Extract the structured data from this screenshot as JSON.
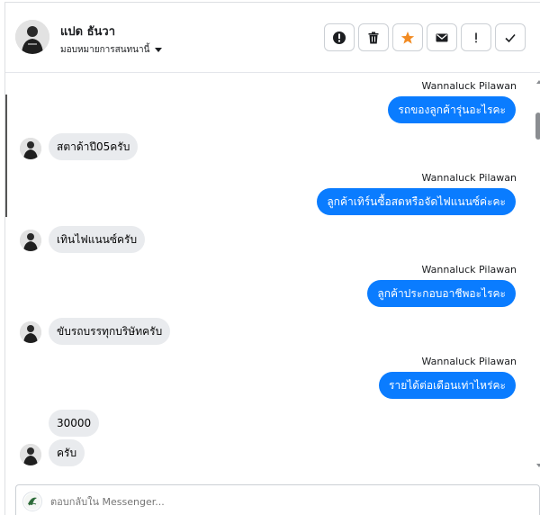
{
  "header": {
    "name": "แปด ธันวา",
    "assign_label": "มอบหมายการสนทนานี้",
    "actions": [
      {
        "icon": "alert-circle-icon",
        "name": "mark-spam-button"
      },
      {
        "icon": "trash-icon",
        "name": "delete-button"
      },
      {
        "icon": "star-icon",
        "name": "star-button",
        "color": "#f28b22"
      },
      {
        "icon": "envelope-icon",
        "name": "mark-unread-button"
      },
      {
        "icon": "exclamation-icon",
        "name": "follow-up-button"
      },
      {
        "icon": "checkmark-icon",
        "name": "mark-done-button"
      }
    ]
  },
  "messages": [
    {
      "dir": "out",
      "sender": "Wannaluck Pilawan",
      "text": "รถของลูกค้ารุ่นอะไรคะ"
    },
    {
      "dir": "in",
      "text": "สตาด้าปี05ครับ"
    },
    {
      "dir": "out",
      "sender": "Wannaluck Pilawan",
      "text": "ลูกค้าเทิร์นซื้อสดหรือจัดไฟแนนซ์ค่ะคะ"
    },
    {
      "dir": "in",
      "text": "เทินไฟแนนซ์ครับ"
    },
    {
      "dir": "out",
      "sender": "Wannaluck Pilawan",
      "text": "ลูกค้าประกอบอาชีพอะไรคะ"
    },
    {
      "dir": "in",
      "text": "ขับรถบรรทุกบริษัทครับ"
    },
    {
      "dir": "out",
      "sender": "Wannaluck Pilawan",
      "text": "รายได้ต่อเดือนเท่าไหร่คะ"
    },
    {
      "dir": "in",
      "text": "30000"
    },
    {
      "dir": "in",
      "text": "ครับ"
    }
  ],
  "composer": {
    "placeholder": "ตอบกลับใน Messenger..."
  },
  "colors": {
    "outgoing_bubble": "#0a7cff",
    "incoming_bubble": "#e9ebee",
    "star": "#f28b22"
  }
}
